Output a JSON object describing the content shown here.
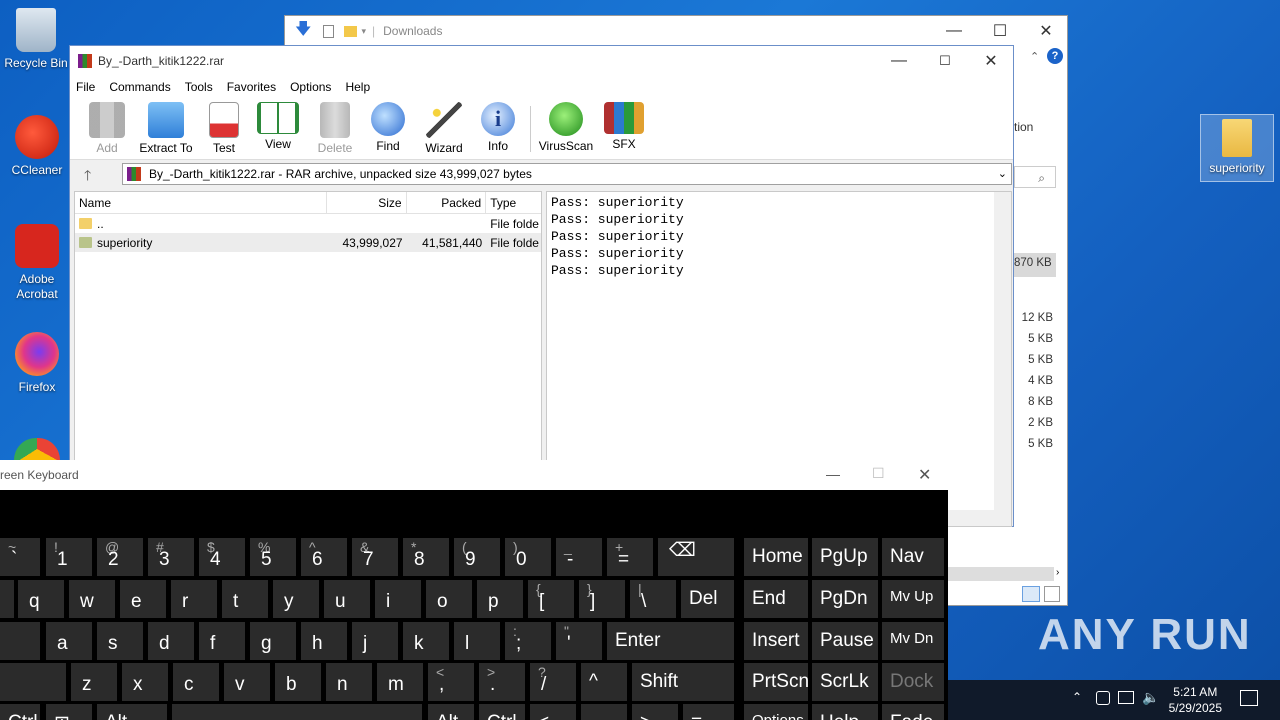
{
  "desktop": {
    "icons": [
      {
        "label": "Recycle Bin"
      },
      {
        "label": "CCleaner"
      },
      {
        "label": "Adobe Acrobat"
      },
      {
        "label": "Firefox"
      }
    ],
    "right_folder": {
      "label": "superiority"
    }
  },
  "explorer": {
    "title": "Downloads",
    "partial_label": "tion",
    "total_size": "870 KB",
    "sizes": [
      "12 KB",
      "5 KB",
      "5 KB",
      "4 KB",
      "8 KB",
      "2 KB",
      "5 KB"
    ]
  },
  "winrar": {
    "title": "By_-Darth_kitik1222.rar",
    "menu": [
      "File",
      "Commands",
      "Tools",
      "Favorites",
      "Options",
      "Help"
    ],
    "toolbar": [
      {
        "label": "Add",
        "icon": "add-icon",
        "enabled": false
      },
      {
        "label": "Extract To",
        "icon": "extract-icon",
        "enabled": true
      },
      {
        "label": "Test",
        "icon": "test-icon",
        "enabled": true
      },
      {
        "label": "View",
        "icon": "view-icon",
        "enabled": true
      },
      {
        "label": "Delete",
        "icon": "delete-icon",
        "enabled": false
      },
      {
        "label": "Find",
        "icon": "find-icon",
        "enabled": true
      },
      {
        "label": "Wizard",
        "icon": "wizard-icon",
        "enabled": true
      },
      {
        "label": "Info",
        "icon": "info-icon",
        "enabled": true
      },
      {
        "label": "VirusScan",
        "icon": "virusscan-icon",
        "enabled": true
      },
      {
        "label": "SFX",
        "icon": "sfx-icon",
        "enabled": true
      }
    ],
    "address": "By_-Darth_kitik1222.rar - RAR archive, unpacked size 43,999,027 bytes",
    "columns": [
      "Name",
      "Size",
      "Packed",
      "Type"
    ],
    "rows": [
      {
        "name": "..",
        "size": "",
        "packed": "",
        "type": "File folde"
      },
      {
        "name": "superiority",
        "size": "43,999,027",
        "packed": "41,581,440",
        "type": "File folde"
      }
    ],
    "comment_lines": [
      "Pass: superiority",
      "Pass: superiority",
      "Pass: superiority",
      "Pass: superiority",
      "Pass: superiority"
    ]
  },
  "keyboard": {
    "title": "reen Keyboard"
  },
  "tray": {
    "time": "5:21 AM",
    "date": "5/29/2025"
  },
  "watermark": "ANY RUN"
}
